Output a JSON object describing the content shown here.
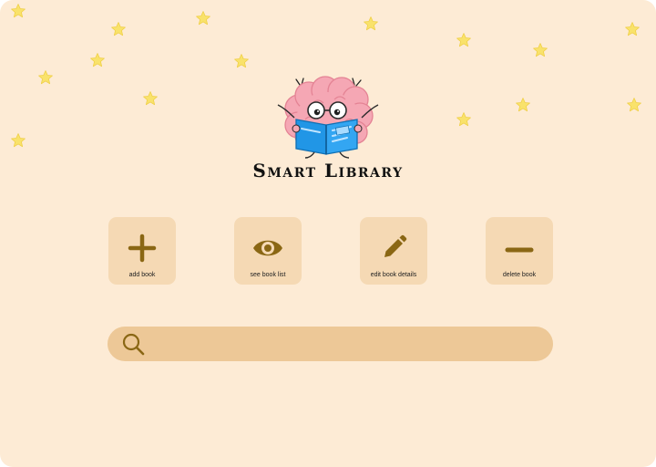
{
  "app": {
    "title": "Smart Library",
    "logo_icon": "brain-reading-book-icon"
  },
  "actions": [
    {
      "id": "add",
      "label": "add book",
      "icon": "plus-icon"
    },
    {
      "id": "view",
      "label": "see book list",
      "icon": "eye-icon"
    },
    {
      "id": "edit",
      "label": "edit book details",
      "icon": "pencil-icon"
    },
    {
      "id": "delete",
      "label": "delete book",
      "icon": "minus-icon"
    }
  ],
  "search": {
    "placeholder": "",
    "value": "",
    "icon": "search-icon"
  },
  "decor": {
    "star_icon": "star-icon"
  },
  "colors": {
    "background": "#fdebd5",
    "card": "#f5d9b4",
    "search_bar": "#edc897",
    "icon": "#8a6714",
    "star": "#f9e26b"
  }
}
